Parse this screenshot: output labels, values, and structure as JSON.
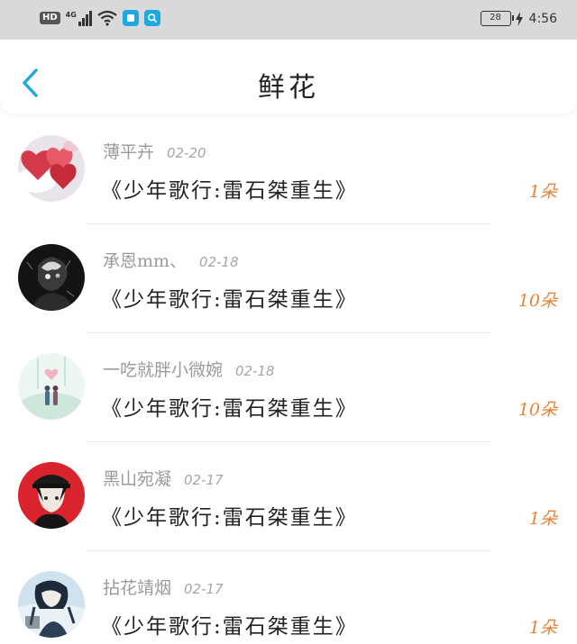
{
  "status_bar": {
    "hd": "HD",
    "network": "4G",
    "battery": "28",
    "time": "4:56",
    "icons": [
      "signal-icon",
      "wifi-icon",
      "app-icon",
      "search-app-icon",
      "charging-icon"
    ]
  },
  "header": {
    "title": "鲜花",
    "back_icon": "chevron-left-icon"
  },
  "colors": {
    "accent": "#1ea8e0",
    "count": "#e8843a",
    "status_bar": "#d9d9d9"
  },
  "items": [
    {
      "name": "薄平卉",
      "date": "02-20",
      "book": "《少年歌行:雷石桀重生》",
      "count": "1朵",
      "avatar": "hearts"
    },
    {
      "name": "承恩mm、",
      "date": "02-18",
      "book": "《少年歌行:雷石桀重生》",
      "count": "10朵",
      "avatar": "dark-portrait"
    },
    {
      "name": "一吃就胖小微婉",
      "date": "02-18",
      "book": "《少年歌行:雷石桀重生》",
      "count": "10朵",
      "avatar": "couple-scene"
    },
    {
      "name": "黑山宛凝",
      "date": "02-17",
      "book": "《少年歌行:雷石桀重生》",
      "count": "1朵",
      "avatar": "red-anime"
    },
    {
      "name": "拈花靖烟",
      "date": "02-17",
      "book": "《少年歌行:雷石桀重生》",
      "count": "1朵",
      "avatar": "blue-anime"
    }
  ]
}
